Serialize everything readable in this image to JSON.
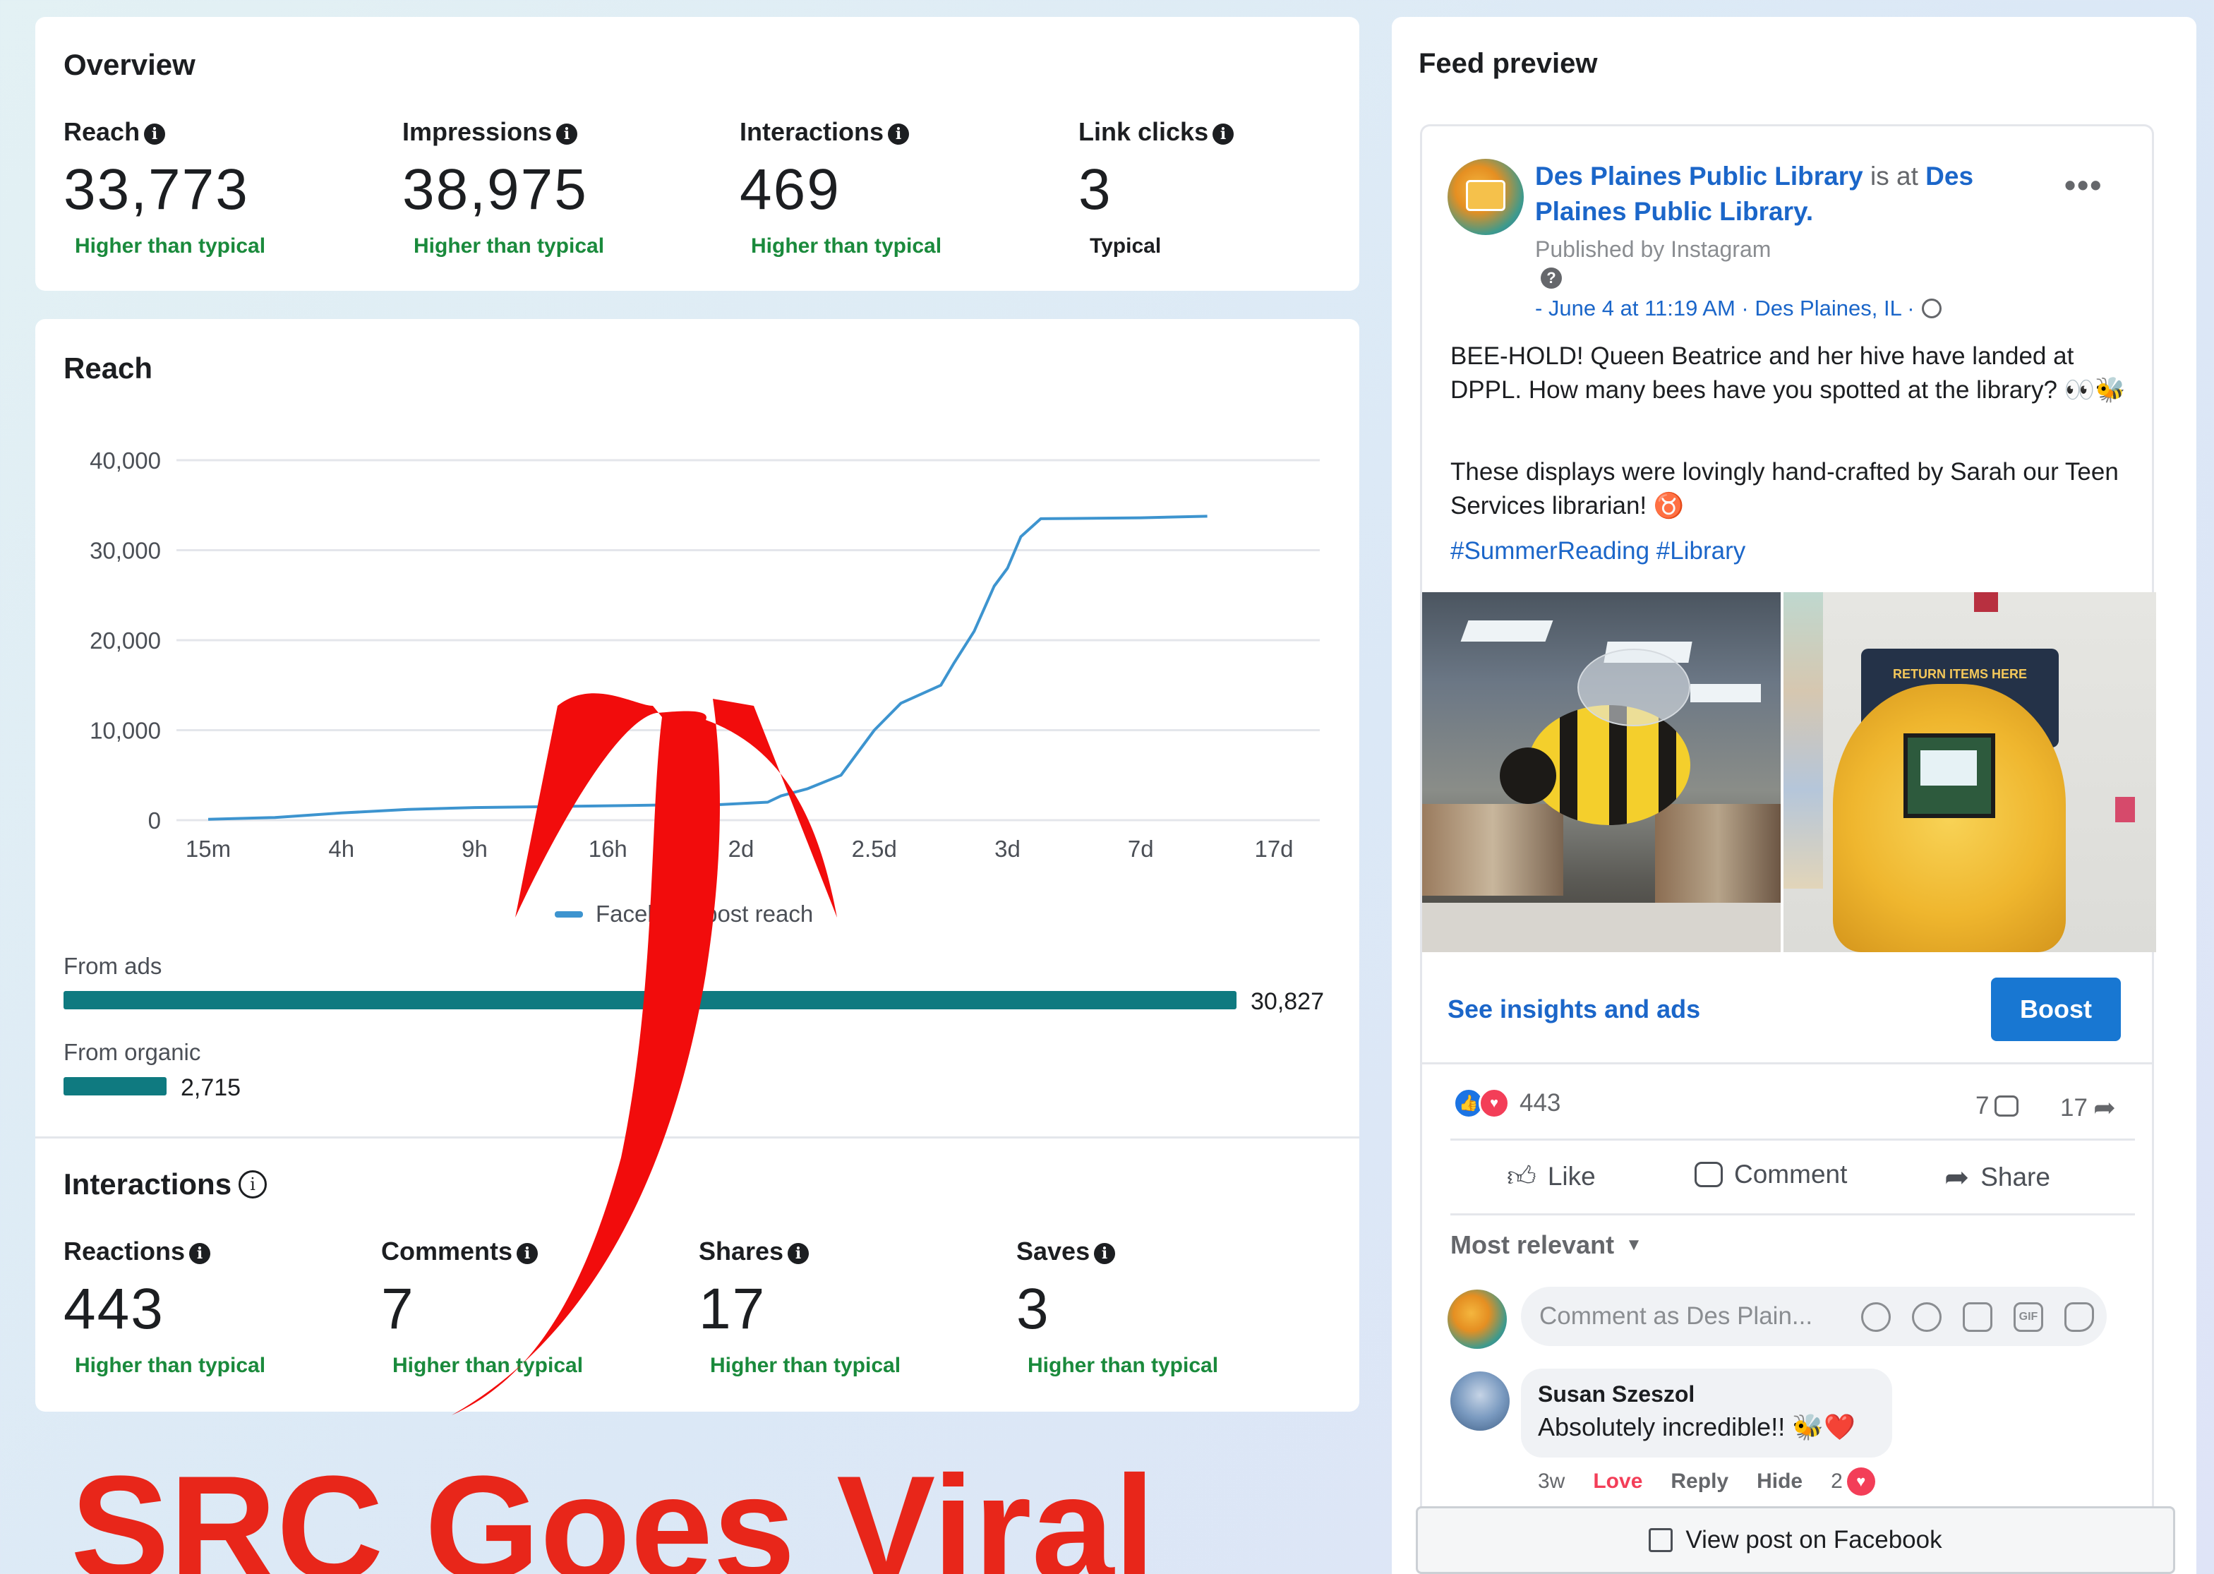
{
  "overview": {
    "title": "Overview",
    "metrics": [
      {
        "label": "Reach",
        "value": "33,773",
        "status": "Higher than typical"
      },
      {
        "label": "Impressions",
        "value": "38,975",
        "status": "Higher than typical"
      },
      {
        "label": "Interactions",
        "value": "469",
        "status": "Higher than typical"
      },
      {
        "label": "Link clicks",
        "value": "3",
        "status": "Typical"
      }
    ]
  },
  "reach": {
    "title": "Reach",
    "legend_label": "Facebook post reach",
    "from_ads_label": "From ads",
    "from_ads_value": "30,827",
    "from_organic_label": "From organic",
    "from_organic_value": "2,715"
  },
  "chart_data": {
    "type": "line",
    "title": "Reach",
    "x_tick_labels": [
      "15m",
      "4h",
      "9h",
      "16h",
      "2d",
      "2.5d",
      "3d",
      "7d",
      "17d"
    ],
    "y_tick_labels": [
      "0",
      "10,000",
      "20,000",
      "30,000",
      "40,000"
    ],
    "ylim": [
      0,
      40000
    ],
    "grid": true,
    "legend_placement": "bottom",
    "series": [
      {
        "name": "Facebook post reach",
        "color": "#3d94cf",
        "points": [
          [
            0,
            100
          ],
          [
            0.5,
            300
          ],
          [
            1,
            800
          ],
          [
            1.5,
            1200
          ],
          [
            2,
            1400
          ],
          [
            2.5,
            1500
          ],
          [
            3,
            1600
          ],
          [
            3.5,
            1700
          ],
          [
            3.8,
            1700
          ],
          [
            4.2,
            2000
          ],
          [
            4.3,
            2700
          ],
          [
            4.5,
            3500
          ],
          [
            4.75,
            5000
          ],
          [
            4.9,
            8000
          ],
          [
            5.0,
            10000
          ],
          [
            5.2,
            13000
          ],
          [
            5.5,
            15000
          ],
          [
            5.6,
            17500
          ],
          [
            5.75,
            21000
          ],
          [
            5.9,
            26000
          ],
          [
            6.0,
            28000
          ],
          [
            6.1,
            31500
          ],
          [
            6.25,
            33500
          ],
          [
            7.0,
            33600
          ],
          [
            7.5,
            33773
          ]
        ]
      }
    ]
  },
  "interactions": {
    "title": "Interactions",
    "metrics": [
      {
        "label": "Reactions",
        "value": "443",
        "status": "Higher than typical"
      },
      {
        "label": "Comments",
        "value": "7",
        "status": "Higher than typical"
      },
      {
        "label": "Shares",
        "value": "17",
        "status": "Higher than typical"
      },
      {
        "label": "Saves",
        "value": "3",
        "status": "Higher than typical"
      }
    ]
  },
  "overlay_text": "SRC Goes Viral",
  "feed": {
    "title": "Feed preview",
    "page_name": "Des Plaines Public Library",
    "is_at": "is at",
    "location_name": "Des Plaines Public Library.",
    "published_by": "Published by Instagram",
    "date_line": "- June 4 at 11:19 AM · Des Plaines, IL ·",
    "post_text_1": "BEE-HOLD! Queen Beatrice and her hive have landed at DPPL. How many bees have you spotted at the library? 👀🐝",
    "post_text_2": "These displays were lovingly hand-crafted by Sarah our Teen Services librarian! ♉",
    "hashtags": "#SummerReading #Library",
    "image_sign_text": "RETURN ITEMS HERE",
    "see_insights": "See insights and ads",
    "boost": "Boost",
    "reaction_count": "443",
    "comment_count": "7",
    "share_count": "17",
    "like": "Like",
    "comment": "Comment",
    "share": "Share",
    "sort": "Most relevant",
    "comment_placeholder": "Comment as Des Plain...",
    "commenter_name": "Susan Szeszol",
    "comment_text": "Absolutely incredible!! 🐝❤️",
    "comment_time": "3w",
    "comment_love": "Love",
    "comment_reply": "Reply",
    "comment_hide": "Hide",
    "comment_react_count": "2",
    "view_post": "View post on Facebook"
  },
  "colors": {
    "status_green": "#1a8a3c",
    "bar_teal": "#0f7a80",
    "fb_blue": "#1b66c9",
    "boost_bg": "#1877d2",
    "arrow_red": "#f20c0c",
    "overlay_red": "#e8261a"
  }
}
